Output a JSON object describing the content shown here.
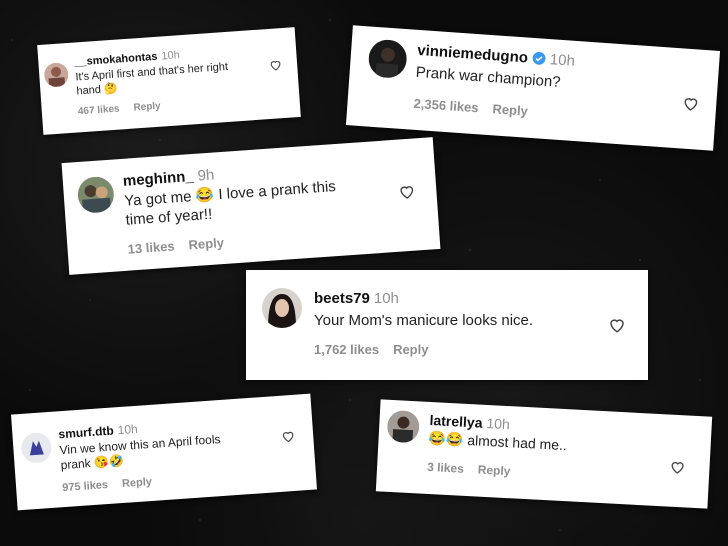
{
  "comments": [
    {
      "username": "__smokahontas",
      "time": "10h",
      "text_lines": [
        "It's April first and that's her right",
        "hand 🤔"
      ],
      "likes": "467 likes",
      "reply": "Reply"
    },
    {
      "username": "vinniemedugno",
      "time": "10h",
      "text_lines": [
        "Prank war champion?"
      ],
      "likes": "2,356 likes",
      "reply": "Reply",
      "verified": true
    },
    {
      "username": "meghinn_",
      "time": "9h",
      "text_lines": [
        "Ya got me 😂 I love a prank this",
        "time of year!!"
      ],
      "likes": "13 likes",
      "reply": "Reply"
    },
    {
      "username": "beets79",
      "time": "10h",
      "text_lines": [
        "Your Mom's manicure looks nice."
      ],
      "likes": "1,762 likes",
      "reply": "Reply"
    },
    {
      "username": "smurf.dtb",
      "time": "10h",
      "text_lines": [
        "Vin we know this an April fools",
        "prank 😘🤣"
      ],
      "likes": "975 likes",
      "reply": "Reply"
    },
    {
      "username": "latrellya",
      "time": "10h",
      "text_lines": [
        "😂😂 almost had me.."
      ],
      "likes": "3 likes",
      "reply": "Reply"
    }
  ],
  "colors": {
    "background": "#0b0b0b",
    "card": "#ffffff",
    "meta_gray": "#8e8e8e",
    "verified_blue": "#3897f0"
  },
  "icons": [
    "heart-outline-icon",
    "verified-badge-icon"
  ]
}
